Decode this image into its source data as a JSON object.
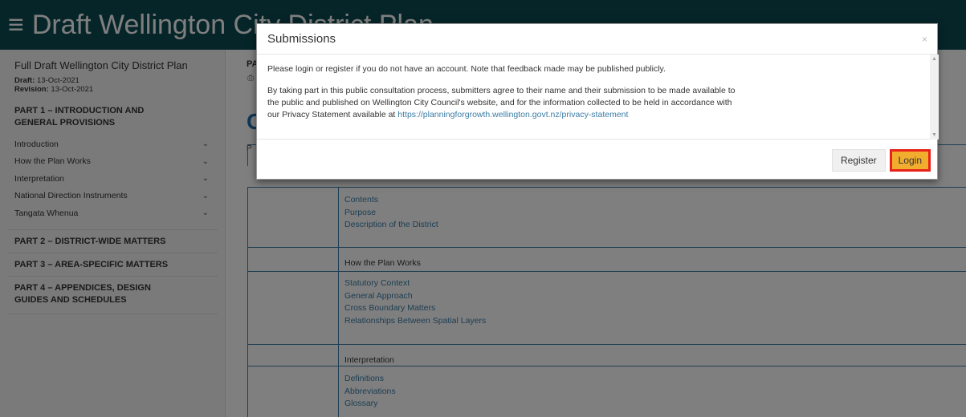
{
  "header": {
    "menu_icon": "hamburger-icon",
    "title": "Draft Wellington City District Plan"
  },
  "sidebar": {
    "title": "Full Draft Wellington City District Plan",
    "draft_label": "Draft:",
    "draft_value": "13-Oct-2021",
    "revision_label": "Revision:",
    "revision_value": "13-Oct-2021",
    "part1_line1": "PART 1 – INTRODUCTION AND",
    "part1_line2": "GENERAL PROVISIONS",
    "items": [
      {
        "label": "Introduction"
      },
      {
        "label": "How the Plan Works"
      },
      {
        "label": "Interpretation"
      },
      {
        "label": "National Direction Instruments"
      },
      {
        "label": "Tangata Whenua"
      }
    ],
    "part2": "PART 2 – DISTRICT-WIDE MATTERS",
    "part3": "PART 3 – AREA-SPECIFIC MATTERS",
    "part4_line1": "PART 4 – APPENDICES, DESIGN",
    "part4_line2": "GUIDES AND SCHEDULES"
  },
  "main": {
    "pa_label": "PA",
    "big_letter": "C",
    "r_letter": "P",
    "sections": [
      {
        "header": "",
        "links": [
          "Contents",
          "Purpose",
          "Description of the District"
        ]
      },
      {
        "header": "How the Plan Works",
        "links": [
          "Statutory Context",
          "General Approach",
          "Cross Boundary Matters",
          "Relationships Between Spatial Layers"
        ]
      },
      {
        "header": "Interpretation",
        "links": [
          "Definitions",
          "Abbreviations",
          "Glossary"
        ]
      }
    ]
  },
  "modal": {
    "title": "Submissions",
    "close": "×",
    "para1": "Please login or register if you do not have an account. Note that feedback made may be published publicly.",
    "para2_line1": "By taking part in this public consultation process, submitters agree to their name and their submission to be made available to",
    "para2_line2": "the public and published on Wellington City Council's website, and for the information collected to be held in accordance with",
    "para2_line3": "our Privacy Statement available at",
    "privacy_link": "https://planningforgrowth.wellington.govt.nz/privacy-statement",
    "register_label": "Register",
    "login_label": "Login",
    "login_highlight_color": "#e8221a",
    "login_bg_color": "#f0ad2e"
  }
}
